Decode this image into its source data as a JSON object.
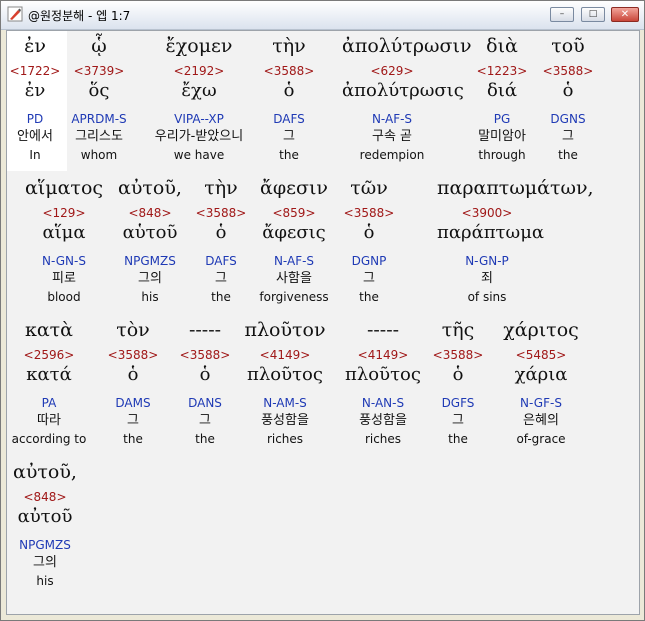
{
  "window": {
    "title": "@원정분해 - 엡 1:7"
  },
  "controls": {
    "minimize": "–",
    "maximize": "□",
    "close": "✕"
  },
  "icons": {
    "app": "pencil-icon"
  },
  "words": [
    {
      "greek": "ἐν",
      "strongs": "<1722>",
      "lemma": "ἐν",
      "parse": "PD",
      "korean": "안에서",
      "english": "In"
    },
    {
      "greek": "ᾧ",
      "strongs": "<3739>",
      "lemma": "ὅς",
      "parse": "APRDM-S",
      "korean": "그리스도",
      "english": "whom"
    },
    {
      "greek": "ἔχομεν",
      "strongs": "<2192>",
      "lemma": "ἔχω",
      "parse": "VIPA--XP",
      "korean": "우리가-받았으니",
      "english": "we have"
    },
    {
      "greek": "τὴν",
      "strongs": "<3588>",
      "lemma": "ὁ",
      "parse": "DAFS",
      "korean": "그",
      "english": "the"
    },
    {
      "greek": "ἀπολύτρωσιν",
      "strongs": "<629>",
      "lemma": "ἀπολύτρωσις",
      "parse": "N-AF-S",
      "korean": "구속 곧",
      "english": "redempion"
    },
    {
      "greek": "διὰ",
      "strongs": "<1223>",
      "lemma": "διά",
      "parse": "PG",
      "korean": "말미암아",
      "english": "through"
    },
    {
      "greek": "τοῦ",
      "strongs": "<3588>",
      "lemma": "ὁ",
      "parse": "DGNS",
      "korean": "그",
      "english": "the"
    },
    {
      "greek": "αἵματος",
      "strongs": "<129>",
      "lemma": "αἵμα",
      "parse": "N-GN-S",
      "korean": "피로",
      "english": "blood"
    },
    {
      "greek": "αὐτοῦ,",
      "strongs": "<848>",
      "lemma": "αὑτοῦ",
      "parse": "NPGMZS",
      "korean": "그의",
      "english": "his"
    },
    {
      "greek": "τὴν",
      "strongs": "<3588>",
      "lemma": "ὁ",
      "parse": "DAFS",
      "korean": "그",
      "english": "the"
    },
    {
      "greek": "ἄφεσιν",
      "strongs": "<859>",
      "lemma": "ἄφεσις",
      "parse": "N-AF-S",
      "korean": "사함을",
      "english": "forgiveness"
    },
    {
      "greek": "τῶν",
      "strongs": "<3588>",
      "lemma": "ὁ",
      "parse": "DGNP",
      "korean": "그",
      "english": "the"
    },
    {
      "greek": "παραπτωμάτων,",
      "strongs": "<3900>",
      "lemma": "παράπτωμα",
      "parse": "N-GN-P",
      "korean": "죄",
      "english": "of sins"
    },
    {
      "greek": "κατὰ",
      "strongs": "<2596>",
      "lemma": "κατά",
      "parse": "PA",
      "korean": "따라",
      "english": "according to"
    },
    {
      "greek": "τὸν",
      "strongs": "<3588>",
      "lemma": "ὁ",
      "parse": "DAMS",
      "korean": "그",
      "english": "the"
    },
    {
      "greek": "-----",
      "strongs": "<3588>",
      "lemma": "ὁ",
      "parse": "DANS",
      "korean": "그",
      "english": "the"
    },
    {
      "greek": "πλοῦτον",
      "strongs": "<4149>",
      "lemma": "πλοῦτος",
      "parse": "N-AM-S",
      "korean": "풍성함을",
      "english": "riches"
    },
    {
      "greek": "-----",
      "strongs": "<4149>",
      "lemma": "πλοῦτος",
      "parse": "N-AN-S",
      "korean": "풍성함을",
      "english": "riches"
    },
    {
      "greek": "τῆς",
      "strongs": "<3588>",
      "lemma": "ὁ",
      "parse": "DGFS",
      "korean": "그",
      "english": "the"
    },
    {
      "greek": "χάριτος",
      "strongs": "<5485>",
      "lemma": "χάρια",
      "parse": "N-GF-S",
      "korean": "은혜의",
      "english": "of-grace"
    },
    {
      "greek": "αὐτοῦ,",
      "strongs": "<848>",
      "lemma": "αὐτοῦ",
      "parse": "NPGMZS",
      "korean": "그의",
      "english": "his"
    }
  ]
}
